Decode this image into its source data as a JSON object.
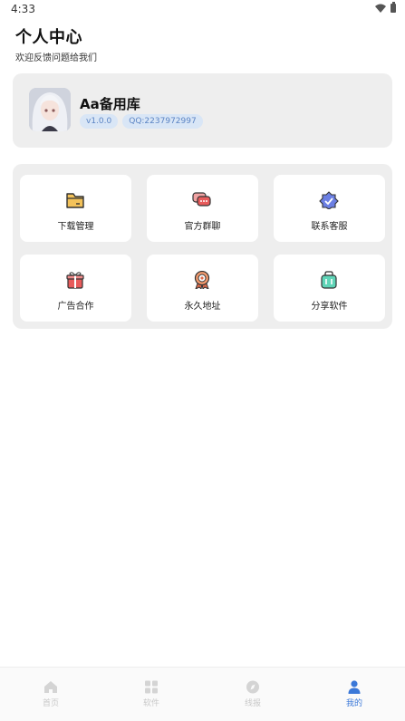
{
  "status_bar": {
    "time": "4:33"
  },
  "header": {
    "title": "个人中心",
    "subtitle": "欢迎反馈问题给我们"
  },
  "profile": {
    "name": "Aa备用库",
    "version_badge": "v1.0.0",
    "qq_badge": "QQ:2237972997"
  },
  "grid": {
    "items": [
      {
        "label": "下载管理",
        "icon": "folder-icon"
      },
      {
        "label": "官方群聊",
        "icon": "chat-icon"
      },
      {
        "label": "联系客服",
        "icon": "verified-badge-icon"
      },
      {
        "label": "广告合作",
        "icon": "gift-icon"
      },
      {
        "label": "永久地址",
        "icon": "medal-icon"
      },
      {
        "label": "分享软件",
        "icon": "bag-icon"
      }
    ]
  },
  "bottom_nav": {
    "items": [
      {
        "label": "首页",
        "icon": "home-icon",
        "active": false
      },
      {
        "label": "软件",
        "icon": "grid-icon",
        "active": false
      },
      {
        "label": "线报",
        "icon": "compass-icon",
        "active": false
      },
      {
        "label": "我的",
        "icon": "person-icon",
        "active": true
      }
    ]
  },
  "colors": {
    "accent": "#3b78d8",
    "card_bg": "#eeeeee",
    "badge_bg": "#d9e6f6",
    "badge_text": "#5b84c4"
  }
}
